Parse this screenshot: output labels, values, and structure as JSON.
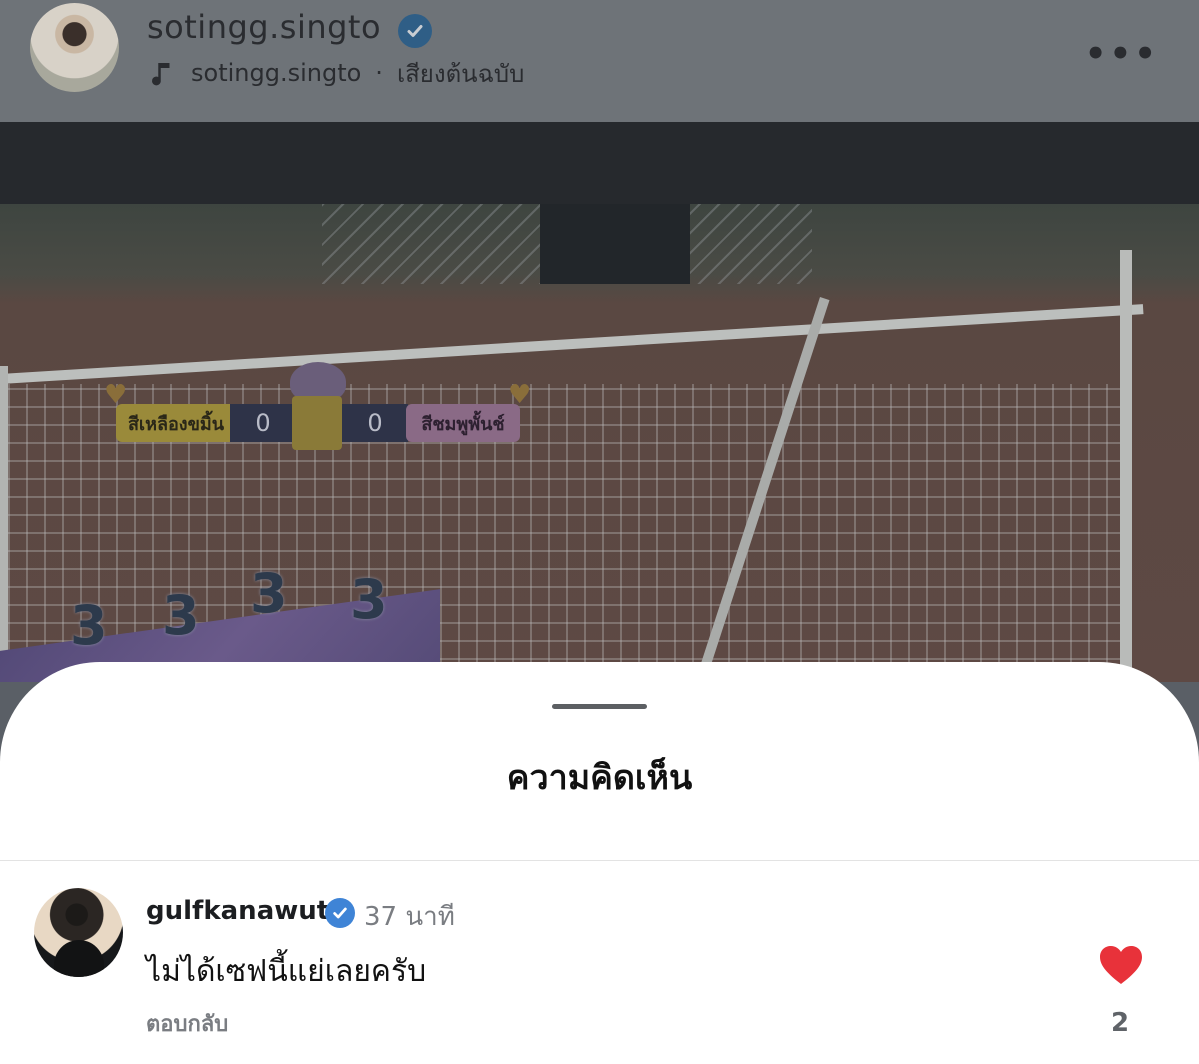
{
  "post_header": {
    "username": "sotingg.singto",
    "audio_owner": "sotingg.singto",
    "audio_separator": "·",
    "audio_label": "เสียงต้นฉบับ",
    "more_label": "•••"
  },
  "video": {
    "scoreboard": {
      "team_left": "สีเหลืองขมิ้น",
      "score_left": "0",
      "score_right": "0",
      "team_right": "สีชมพูพั้นช์"
    },
    "banner_numbers": [
      "3",
      "3",
      "3",
      "3"
    ]
  },
  "comments_sheet": {
    "title": "ความคิดเห็น",
    "comments": [
      {
        "username": "gulfkanawut",
        "time": "37 นาที",
        "text": "ไม่ได้เซฟนี้แย่เลยครับ",
        "reply_label": "ตอบกลับ",
        "like_count": "2"
      }
    ]
  },
  "colors": {
    "verified_badge": "#3f84d6",
    "like_heart": "#e8323a",
    "overlay": "#6e7378"
  },
  "icons": {
    "verified": "verified-badge-icon",
    "music": "music-note-icon",
    "more": "more-options-icon",
    "heart": "heart-filled-icon"
  }
}
